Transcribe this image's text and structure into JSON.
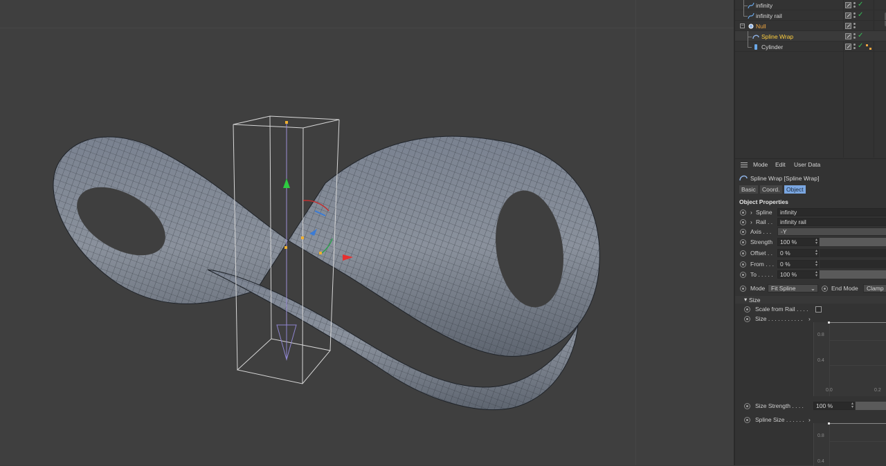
{
  "objects": [
    {
      "name": "infinity",
      "icon": "spline-icon"
    },
    {
      "name": "infinity rail",
      "icon": "spline-icon"
    },
    {
      "name": "Null",
      "icon": "null-icon"
    },
    {
      "name": "Spline Wrap",
      "icon": "spline-wrap-icon"
    },
    {
      "name": "Cylinder",
      "icon": "cylinder-icon"
    }
  ],
  "attr": {
    "menu": [
      "Mode",
      "Edit",
      "User Data"
    ],
    "title": "Spline Wrap [Spline Wrap]",
    "tabs": [
      "Basic",
      "Coord.",
      "Object"
    ],
    "active_tab": "Object",
    "section": "Object Properties",
    "spline_label": "Spline",
    "spline_value": "infinity",
    "rail_label": "Rail . .",
    "rail_value": "infinity rail",
    "axis_label": "Axis . . .",
    "axis_value": "-Y",
    "strength_label": "Strength",
    "strength_value": "100 %",
    "offset_label": "Offset . .",
    "offset_value": "0 %",
    "from_label": "From . . .",
    "from_value": "0 %",
    "to_label": "To . . . . .",
    "to_value": "100 %",
    "mode_label": "Mode",
    "mode_value": "Fit Spline",
    "endmode_label": "End Mode",
    "endmode_value": "Clamp",
    "size_group": "Size",
    "scale_from_rail_label": "Scale from Rail . . . .",
    "size_label": "Size . . . . . . . . . . .",
    "size_graph_ticks": [
      "0.8",
      "0.4",
      "0.0",
      "0.2"
    ],
    "size_strength_label": "Size Strength . . . .",
    "size_strength_value": "100 %",
    "spline_size_label": "Spline Size . . . . . .",
    "spline_size_graph_ticks": [
      "0.8",
      "0.4"
    ]
  },
  "colors": {
    "accent_tab": "#7aa6e0",
    "null_name": "#f0a640",
    "selected_name": "#ffcf3f",
    "check": "#37c25a",
    "axis_y": "#2ecc40",
    "axis_x": "#e63030",
    "axis_z": "#3a7bd5"
  }
}
